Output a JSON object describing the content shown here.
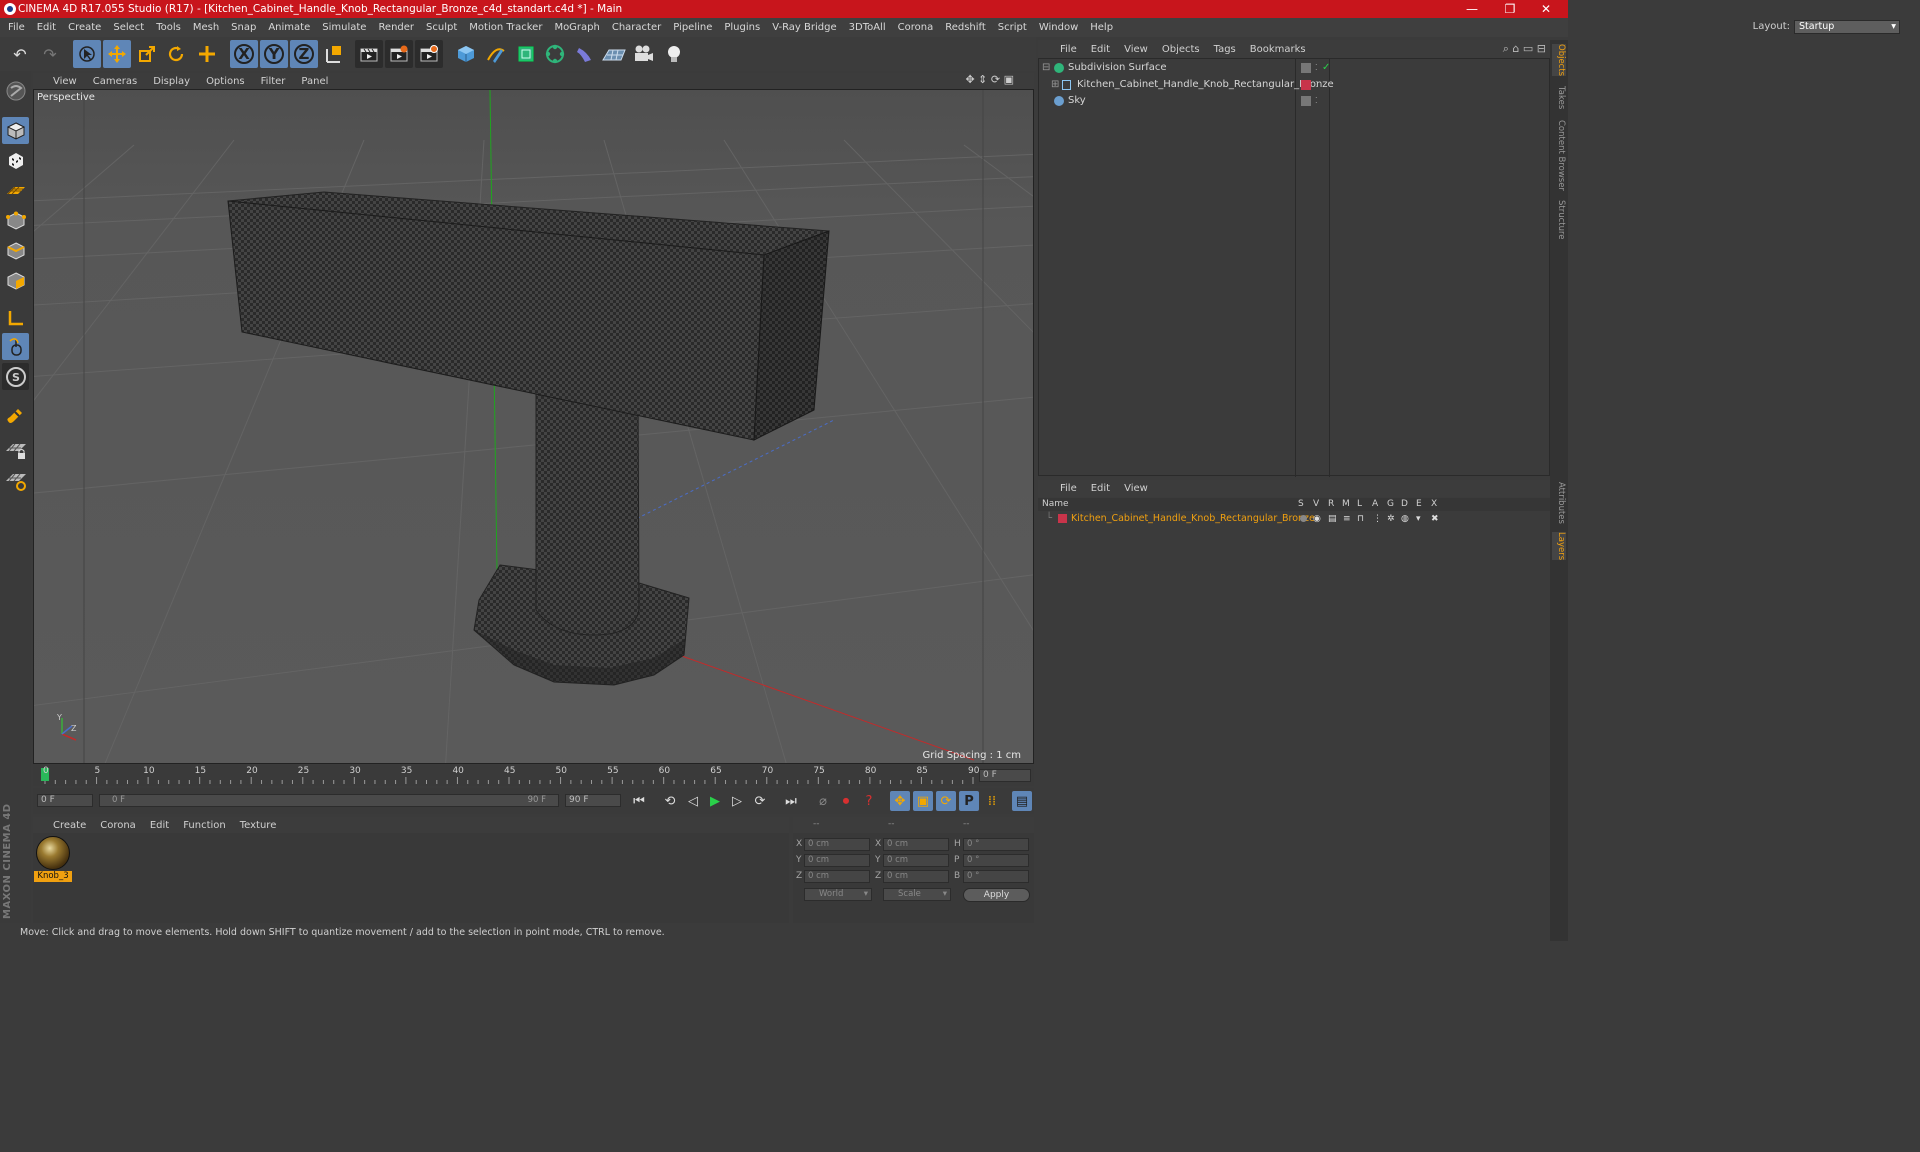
{
  "window": {
    "title": "CINEMA 4D R17.055 Studio (R17) - [Kitchen_Cabinet_Handle_Knob_Rectangular_Bronze_c4d_standart.c4d *] - Main",
    "minimize": "—",
    "restore": "❐",
    "close": "✕"
  },
  "menubar": {
    "items": [
      "File",
      "Edit",
      "Create",
      "Select",
      "Tools",
      "Mesh",
      "Snap",
      "Animate",
      "Simulate",
      "Render",
      "Sculpt",
      "Motion Tracker",
      "MoGraph",
      "Character",
      "Pipeline",
      "Plugins",
      "V-Ray Bridge",
      "3DToAll",
      "Corona",
      "Redshift",
      "Script",
      "Window",
      "Help"
    ],
    "layout_label": "Layout:",
    "layout_value": "Startup"
  },
  "toolbar": {
    "icons": [
      "undo-icon",
      "redo-icon",
      "select-icon",
      "move-icon",
      "scale-icon",
      "rotate-icon",
      "add-icon",
      "x-axis-icon",
      "y-axis-icon",
      "z-axis-icon",
      "coordinate-system-icon",
      "render-region-icon",
      "render-view-icon",
      "render-settings-icon",
      "cube-icon",
      "pen-icon",
      "subdivision-icon",
      "array-icon",
      "deformer-icon",
      "floor-icon",
      "camera-icon",
      "light-icon"
    ],
    "x_label": "X",
    "y_label": "Y",
    "z_label": "Z"
  },
  "viewport": {
    "menu": [
      "View",
      "Cameras",
      "Display",
      "Options",
      "Filter",
      "Panel"
    ],
    "label": "Perspective",
    "grid_spacing": "Grid Spacing : 1 cm",
    "axis_y": "Y",
    "axis_z": "Z"
  },
  "timeline": {
    "ticks": [
      "0",
      "5",
      "10",
      "15",
      "20",
      "25",
      "30",
      "35",
      "40",
      "45",
      "50",
      "55",
      "60",
      "65",
      "70",
      "75",
      "80",
      "85",
      "90"
    ],
    "current_frame": "0 F",
    "start_field": "0 F",
    "range_start": "0 F",
    "range_end": "90 F",
    "end_field": "90 F"
  },
  "materials": {
    "menu": [
      "Create",
      "Corona",
      "Edit",
      "Function",
      "Texture"
    ],
    "items": [
      {
        "name": "Knob_3"
      }
    ]
  },
  "coordinates": {
    "header": [
      "--",
      "--",
      "--"
    ],
    "rows": [
      {
        "axis": "X",
        "pos": "0 cm",
        "size_axis": "X",
        "size": "0 cm",
        "rot_axis": "H",
        "rot": "0 °"
      },
      {
        "axis": "Y",
        "pos": "0 cm",
        "size_axis": "Y",
        "size": "0 cm",
        "rot_axis": "P",
        "rot": "0 °"
      },
      {
        "axis": "Z",
        "pos": "0 cm",
        "size_axis": "Z",
        "size": "0 cm",
        "rot_axis": "B",
        "rot": "0 °"
      }
    ],
    "world": "World",
    "scale": "Scale",
    "apply": "Apply"
  },
  "status": "Move: Click and drag to move elements. Hold down SHIFT to quantize movement / add to the selection in point mode, CTRL to remove.",
  "objects": {
    "menu": [
      "File",
      "Edit",
      "View",
      "Objects",
      "Tags",
      "Bookmarks"
    ],
    "items": [
      {
        "name": "Subdivision Surface"
      },
      {
        "name": "Kitchen_Cabinet_Handle_Knob_Rectangular_Bronze"
      },
      {
        "name": "Sky"
      }
    ]
  },
  "layers": {
    "menu": [
      "File",
      "Edit",
      "View"
    ],
    "columns": [
      "Name",
      "S",
      "V",
      "R",
      "M",
      "L",
      "A",
      "G",
      "D",
      "E",
      "X"
    ],
    "items": [
      {
        "name": "Kitchen_Cabinet_Handle_Knob_Rectangular_Bronze",
        "color": "#c8344a"
      }
    ]
  },
  "right_tabs": [
    "Objects",
    "Takes",
    "Content Browser",
    "Structure",
    "Attributes",
    "Layers"
  ],
  "brand": "MAXON CINEMA 4D",
  "colors": {
    "accent": "#5f86b7",
    "highlight": "#f0a010",
    "title_bar": "#c8151c"
  }
}
